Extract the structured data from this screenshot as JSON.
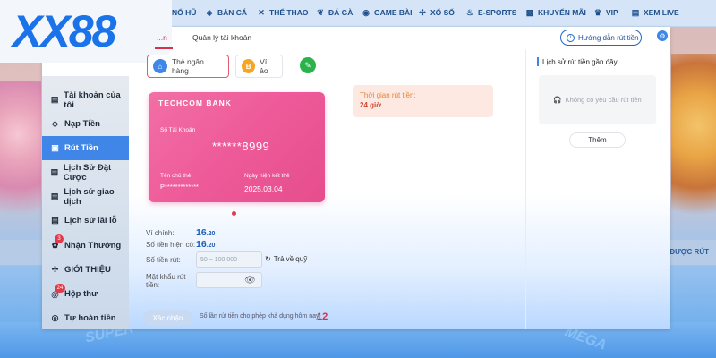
{
  "logo": {
    "text": "XX88"
  },
  "topnav": [
    {
      "icon": "slot-icon",
      "glyph": "▣",
      "label": "NỔ HŨ"
    },
    {
      "icon": "fish-icon",
      "glyph": "◈",
      "label": "BẮN CÁ"
    },
    {
      "icon": "sports-icon",
      "glyph": "✕",
      "label": "THỂ THAO"
    },
    {
      "icon": "rooster-icon",
      "glyph": "❦",
      "label": "ĐÁ GÀ"
    },
    {
      "icon": "gamepad-icon",
      "glyph": "◉",
      "label": "GAME BÀI"
    },
    {
      "icon": "lottery-icon",
      "glyph": "✣",
      "label": "XỔ SỐ"
    },
    {
      "icon": "esports-icon",
      "glyph": "♨",
      "label": "E-SPORTS"
    },
    {
      "icon": "gift-icon",
      "glyph": "▩",
      "label": "KHUYẾN MÃI"
    },
    {
      "icon": "crown-icon",
      "glyph": "♛",
      "label": "VIP"
    },
    {
      "icon": "live-icon",
      "glyph": "▤",
      "label": "XEM LIVE"
    }
  ],
  "tabs": {
    "active": "...n",
    "second": "Quản lý tài khoản"
  },
  "guide_button": "Hướng dẫn rút tiền",
  "sidebar": [
    {
      "icon": "account-icon",
      "glyph": "▤",
      "label": "Tài khoản của tôi"
    },
    {
      "icon": "deposit-icon",
      "glyph": "◇",
      "label": "Nạp Tiền"
    },
    {
      "icon": "withdraw-icon",
      "glyph": "▣",
      "label": "Rút Tiền",
      "active": true
    },
    {
      "icon": "bet-history-icon",
      "glyph": "▤",
      "label": "Lịch Sử Đặt Cược"
    },
    {
      "icon": "transaction-icon",
      "glyph": "▤",
      "label": "Lịch sử giao dịch"
    },
    {
      "icon": "loss-history-icon",
      "glyph": "▤",
      "label": "Lịch sử lãi lỗ"
    },
    {
      "icon": "reward-icon",
      "glyph": "✿",
      "label": "Nhận Thưởng",
      "badge": "3"
    },
    {
      "icon": "referral-icon",
      "glyph": "✢",
      "label": "GIỚI THIỆU"
    },
    {
      "icon": "mailbox-icon",
      "glyph": "@",
      "label": "Hộp thư",
      "badge": "24"
    },
    {
      "icon": "refund-icon",
      "glyph": "◎",
      "label": "Tự hoàn tiền"
    }
  ],
  "methods": {
    "bank": "Thẻ ngân hàng",
    "wallet": "Ví ảo"
  },
  "card": {
    "bank_name": "TECHCOM BANK",
    "account_label": "Số Tài Khoản",
    "account_number": "******8999",
    "owner_label": "Tên chủ thẻ",
    "owner_value": "P*************",
    "expiry_label": "Ngày hiện kết thẻ",
    "expiry_value": "2025.03.04"
  },
  "withdraw_time": {
    "label": "Thời gian rút tiền:",
    "value": "24 giờ"
  },
  "history": {
    "title": "Lịch sử rút tiền gần đây",
    "empty_text": "Không có yêu cầu rút tiền",
    "more_button": "Thêm"
  },
  "form": {
    "main_wallet_label": "Ví chính:",
    "main_wallet_int": "16",
    "main_wallet_dec": ".20",
    "withdrawable_label": "Số tiền hiện có:",
    "withdrawable_int": "16",
    "withdrawable_dec": ".20",
    "amount_label": "Số tiền rút:",
    "amount_placeholder": "50 ~ 100,000",
    "back_link": "Trả về quỹ",
    "password_label": "Mật khẩu rút tiền:",
    "submit_button": "Xác nhận",
    "remaining_label": "Số lần rút tiền cho phép khả dụng hôm nay:",
    "remaining_count": "12"
  },
  "background": {
    "strip_text": "ĐƯỢC RÚT",
    "left_text": "SUPER",
    "right_text": "MEGA"
  },
  "colors": {
    "accent_blue": "#3f86e8",
    "accent_red": "#d6304a",
    "card_pink": "#ee5a99"
  }
}
